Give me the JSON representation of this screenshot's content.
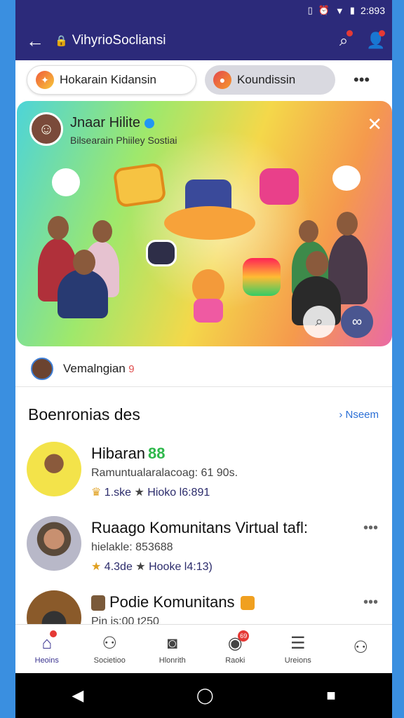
{
  "status": {
    "icons": [
      "N",
      "alarm-icon",
      "wifi-icon",
      "battery-icon"
    ],
    "time": "2:893"
  },
  "appbar": {
    "title": "VihyrioSocliansi"
  },
  "chips": [
    {
      "label": "Hokarain Kidansin"
    },
    {
      "label": "Koundissin"
    }
  ],
  "hero": {
    "name": "Jnaar Hilite",
    "subtitle": "Bilsearain Phiiley Sostiai"
  },
  "poster": {
    "name": "Vemalngian",
    "count": "9"
  },
  "section": {
    "heading": "Boenronias des",
    "link": "Nseem"
  },
  "items": [
    {
      "title": "Hibaran",
      "badge": "88",
      "meta": "Ramuntualaralacoag: 61 90s.",
      "stat1": "1.ske",
      "stat2": "Hioko l6:891"
    },
    {
      "title": "Ruaago Komunitans Virtual tafl:",
      "badge": "",
      "meta": "hielakle: 853688",
      "stat1": "4.3de",
      "stat2": "Hooke l4:13)"
    },
    {
      "title": "Podie Komunitans",
      "badge": "",
      "meta": "Pin                is:00 t250",
      "stat1": "",
      "stat2": ""
    }
  ],
  "nav": [
    {
      "label": "Heoins",
      "badge": "",
      "active": true
    },
    {
      "label": "Societioo",
      "badge": ""
    },
    {
      "label": "Hlonrith",
      "badge": ""
    },
    {
      "label": "Raoki",
      "badge": "69"
    },
    {
      "label": "Ureions",
      "badge": ""
    },
    {
      "label": "",
      "badge": ""
    }
  ],
  "colors": {
    "primary": "#2c2a7a",
    "accent": "#2b6fd6",
    "badge": "#e53935",
    "success": "#2eb84b"
  }
}
